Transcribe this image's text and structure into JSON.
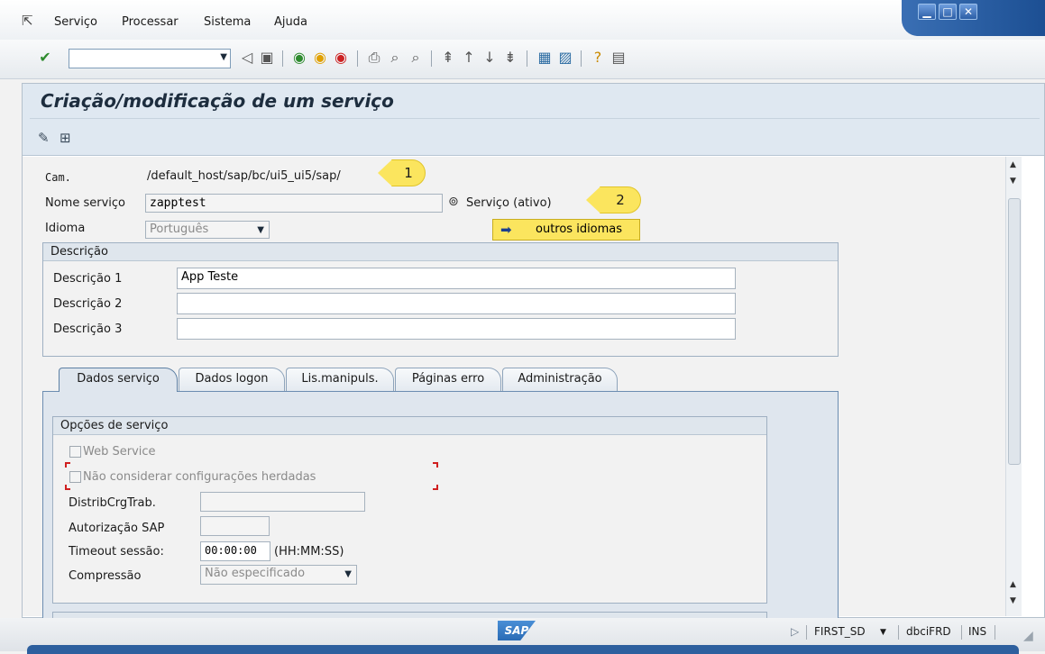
{
  "menubar": {
    "items": [
      "Serviço",
      "Processar",
      "Sistema",
      "Ajuda"
    ]
  },
  "window_controls": [
    "minimize",
    "maximize",
    "close"
  ],
  "toolbar": {
    "command_field_value": ""
  },
  "page": {
    "title": "Criação/modificação de um serviço"
  },
  "header_fields": {
    "path_label": "Cam.",
    "path_value": "/default_host/sap/bc/ui5_ui5/sap/",
    "service_name_label": "Nome serviço",
    "service_name_value": "zapptest",
    "service_status": "Serviço (ativo)",
    "language_label": "Idioma",
    "language_value": "Português",
    "other_languages_button": "outros idiomas"
  },
  "callouts": [
    "1",
    "2"
  ],
  "description": {
    "title": "Descrição",
    "rows": [
      {
        "label": "Descrição 1",
        "value": "App Teste"
      },
      {
        "label": "Descrição 2",
        "value": ""
      },
      {
        "label": "Descrição 3",
        "value": ""
      }
    ]
  },
  "tabs": [
    "Dados serviço",
    "Dados logon",
    "Lis.manipuls.",
    "Páginas erro",
    "Administração"
  ],
  "service_options": {
    "title": "Opções de serviço",
    "web_service_label": "Web Service",
    "web_service_checked": false,
    "ignore_inherited_label": "Não considerar configurações herdadas",
    "ignore_inherited_checked": false,
    "load_dist_label": "DistribCrgTrab.",
    "load_dist_value": "",
    "sap_auth_label": "Autorização SAP",
    "sap_auth_value": "",
    "timeout_label": "Timeout sessão:",
    "timeout_value": "00:00:00",
    "timeout_hint": "(HH:MM:SS)",
    "compression_label": "Compressão",
    "compression_value": "Não especificado"
  },
  "statusbar": {
    "logo": "SAP",
    "system": "FIRST_SD",
    "server": "dbciFRD",
    "mode": "INS"
  }
}
